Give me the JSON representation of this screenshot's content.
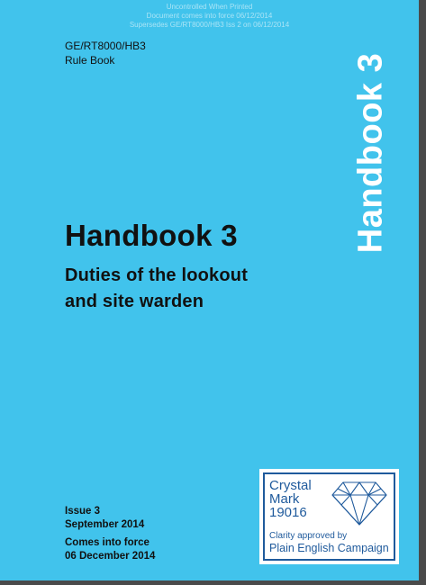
{
  "watermark": {
    "lines": [
      "Uncontrolled When Printed",
      "Document comes into force 06/12/2014",
      "Supersedes GE/RT8000/HB3 Iss 2 on 06/12/2014"
    ]
  },
  "document": {
    "code": "GE/RT8000/HB3",
    "type": "Rule Book"
  },
  "side_title": "Handbook 3",
  "title": "Handbook 3",
  "subtitle": {
    "line1": "Duties of the lookout",
    "line2": "and site warden"
  },
  "issue": {
    "number": "Issue 3",
    "date": "September 2014",
    "force_label": "Comes into force",
    "force_date": "06 December 2014"
  },
  "crystal_mark": {
    "line1": "Crystal",
    "line2": "Mark",
    "number": "19016",
    "approved": "Clarity approved by",
    "campaign": "Plain English Campaign"
  },
  "colors": {
    "background": "#41c3ec",
    "text": "#111111",
    "side_title": "#ffffff",
    "crystal_mark_blue": "#1f5a9c"
  }
}
